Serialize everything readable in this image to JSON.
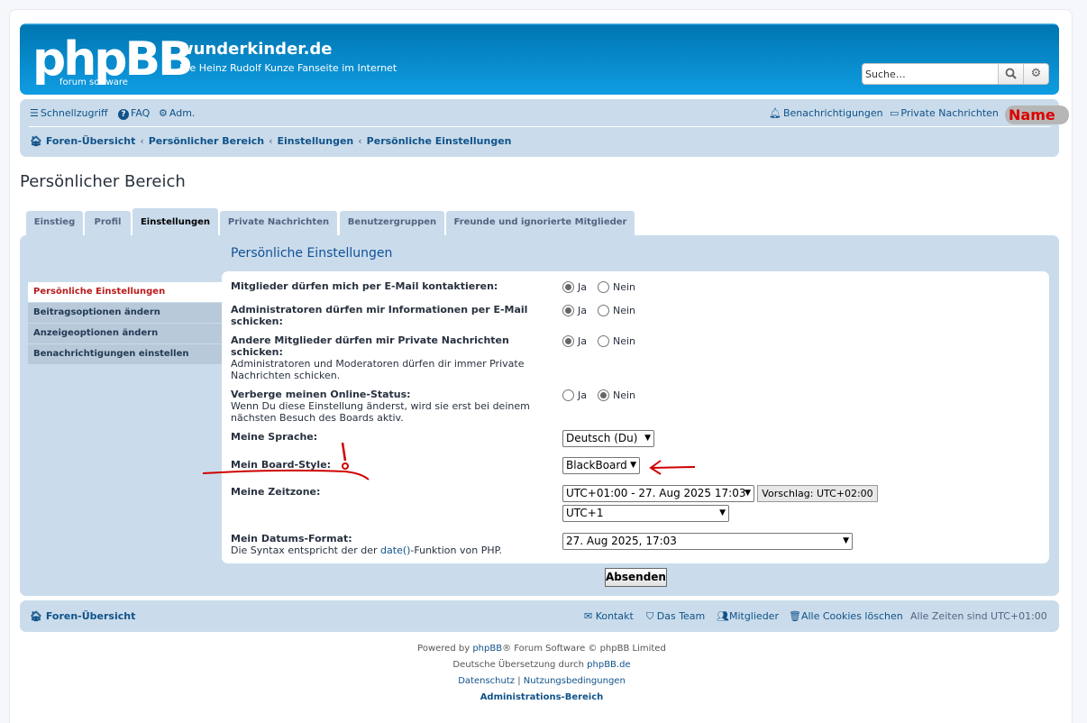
{
  "header": {
    "logo_text": "phpBB",
    "logo_sub": "forum  software",
    "site_name": "wunderkinder.de",
    "site_desc": "Die Heinz Rudolf Kunze Fanseite im Internet",
    "search_placeholder": "Suche…"
  },
  "navbar": {
    "quick_links": "Schnellzugriff",
    "faq": "FAQ",
    "adm": "Adm.",
    "notifications": "Benachrichtigungen",
    "private_messages": "Private Nachrichten",
    "name_badge": "Name",
    "breadcrumbs": [
      "Foren-Übersicht",
      "Persönlicher Bereich",
      "Einstellungen",
      "Persönliche Einstellungen"
    ]
  },
  "page_title": "Persönlicher Bereich",
  "tabs": [
    "Einstieg",
    "Profil",
    "Einstellungen",
    "Private Nachrichten",
    "Benutzergruppen",
    "Freunde und ignorierte Mitglieder"
  ],
  "panel_title": "Persönliche Einstellungen",
  "side_menu": [
    "Persönliche Einstellungen",
    "Beitragsoptionen ändern",
    "Anzeigeoptionen ändern",
    "Benachrichtigungen einstellen"
  ],
  "form": {
    "yes": "Ja",
    "no": "Nein",
    "email_label": "Mitglieder dürfen mich per E-Mail kontaktieren:",
    "admin_label": "Administratoren dürfen mir Informationen per E-Mail schicken:",
    "pm_label": "Andere Mitglieder dürfen mir Private Nachrichten schicken:",
    "pm_explain": "Administratoren und Moderatoren dürfen dir immer Private Nachrichten schicken.",
    "online_label": "Verberge meinen Online-Status:",
    "online_explain": "Wenn Du diese Einstellung änderst, wird sie erst bei deinem nächsten Besuch des Boards aktiv.",
    "lang_label": "Meine Sprache:",
    "lang_value": "Deutsch (Du)",
    "style_label": "Mein Board-Style:",
    "style_value": "BlackBoard",
    "tz_label": "Meine Zeitzone:",
    "tz_value": "UTC+01:00 - 27. Aug 2025 17:03",
    "tz_suggest": "Vorschlag: UTC+02:00",
    "tz_value2": "UTC+1",
    "date_label": "Mein Datums-Format:",
    "date_explain_pre": "Die Syntax entspricht der der ",
    "date_explain_link": "date()",
    "date_explain_post": "-Funktion von PHP.",
    "date_value": "27. Aug 2025, 17:03",
    "submit": "Absenden"
  },
  "footer": {
    "home": "Foren-Übersicht",
    "contact": "Kontakt",
    "team": "Das Team",
    "members": "Mitglieder",
    "cookies": "Alle Cookies löschen",
    "timezone": "Alle Zeiten sind UTC+01:00"
  },
  "copyright": {
    "powered_pre": "Powered by ",
    "phpbb": "phpBB",
    "powered_post": "® Forum Software © phpBB Limited",
    "translation_pre": "Deutsche Übersetzung durch ",
    "translation_link": "phpBB.de",
    "privacy": "Datenschutz",
    "sep": "|",
    "terms": "Nutzungsbedingungen",
    "admin": "Administrations-Bereich"
  },
  "colors": {
    "link": "#105289",
    "header": "#12a3eb",
    "navbar": "#cadceb",
    "annotation": "#d00000"
  }
}
